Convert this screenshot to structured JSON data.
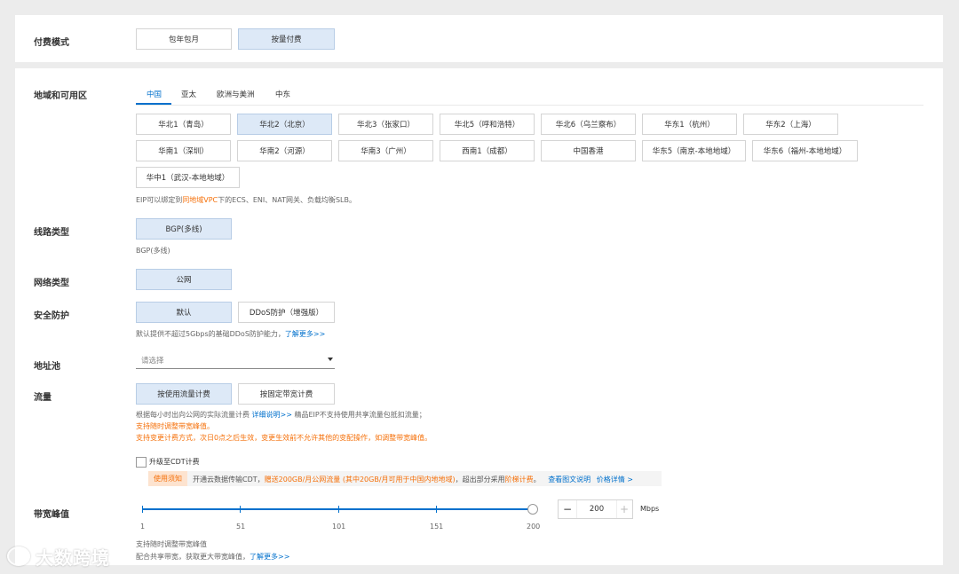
{
  "billing": {
    "label": "付费模式",
    "options": [
      "包年包月",
      "按量付费"
    ],
    "selected": 1
  },
  "region": {
    "label": "地域和可用区",
    "tabs": [
      "中国",
      "亚太",
      "欧洲与美洲",
      "中东"
    ],
    "active_tab": 0,
    "zones": [
      [
        "华北1（青岛）",
        "华北2（北京）",
        "华北3（张家口）",
        "华北5（呼和浩特）",
        "华北6（乌兰察布）",
        "华东1（杭州）",
        "华东2（上海）"
      ],
      [
        "华南1（深圳）",
        "华南2（河源）",
        "华南3（广州）",
        "西南1（成都）",
        "中国香港",
        "华东5（南京-本地地域）",
        "华东6（福州-本地地域）"
      ],
      [
        "华中1（武汉-本地地域）"
      ]
    ],
    "selected_zone": "华北2（北京）",
    "note_prefix": "EIP可以绑定到",
    "note_link": "同地域VPC",
    "note_suffix": "下的ECS、ENI、NAT网关、负载均衡SLB。"
  },
  "line": {
    "label": "线路类型",
    "option": "BGP(多线)",
    "note": "BGP(多线)"
  },
  "network": {
    "label": "网络类型",
    "option": "公网"
  },
  "security": {
    "label": "安全防护",
    "options": [
      "默认",
      "DDoS防护（增强版）"
    ],
    "selected": 0,
    "note": "默认提供不超过5Gbps的基础DDoS防护能力，",
    "note_link": "了解更多>>"
  },
  "address_pool": {
    "label": "地址池",
    "placeholder": "请选择"
  },
  "traffic": {
    "label": "流量",
    "options": [
      "按使用流量计费",
      "按固定带宽计费"
    ],
    "selected": 0,
    "note1_prefix": "根据每小时出向公网的实际流量计费",
    "note1_link": "详细说明>>",
    "note1_suffix": "精品EIP不支持使用共享流量包抵扣流量；",
    "note2": "支持随时调整带宽峰值。",
    "note3": "支持变更计费方式，次日0点之后生效，变更生效前不允许其他的变配操作，如调整带宽峰值。",
    "cdt_checkbox": "升级至CDT计费",
    "cdt_tag": "使用须知",
    "cdt_text_prefix": "开通云数据传输CDT，",
    "cdt_text_orange": "赠送200GB/月公网流量 (其中20GB/月可用于中国内地地域)",
    "cdt_text_mid": "，超出部分采用",
    "cdt_text_orange2": "阶梯计费",
    "cdt_text_end": "。",
    "cdt_link1": "查看图文说明",
    "cdt_link2": "价格详情 >"
  },
  "bandwidth": {
    "label": "带宽峰值",
    "ticks": [
      "1",
      "51",
      "101",
      "151",
      "200"
    ],
    "value": "200",
    "min": 1,
    "max": 200,
    "current": 200,
    "minus": "−",
    "plus": "+",
    "unit": "Mbps",
    "note1": "支持随时调整带宽峰值",
    "note2": "配合共享带宽，获取更大带宽峰值，",
    "note2_link": "了解更多>>"
  },
  "watermark": "大数跨境"
}
